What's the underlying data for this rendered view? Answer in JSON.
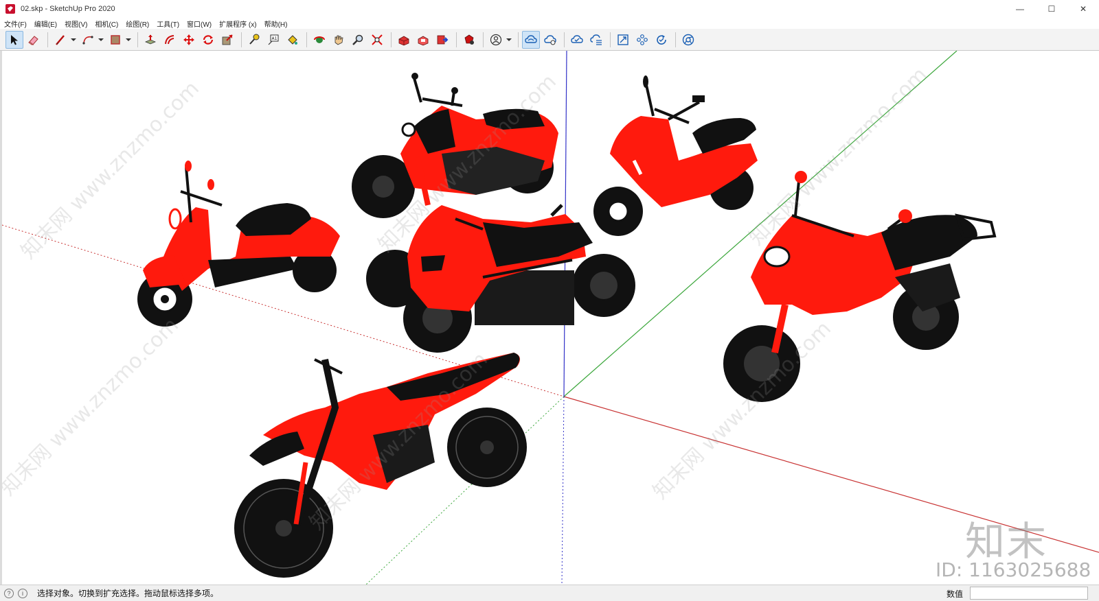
{
  "window": {
    "title": "02.skp - SketchUp Pro 2020",
    "controls": [
      "—",
      "☐",
      "✕"
    ]
  },
  "menu": [
    "文件(F)",
    "编辑(E)",
    "视图(V)",
    "相机(C)",
    "绘图(R)",
    "工具(T)",
    "窗口(W)",
    "扩展程序 (x)",
    "帮助(H)"
  ],
  "toolbar": {
    "tools": [
      "select-tool",
      "eraser-tool",
      "line-tool",
      "arc-tool",
      "shape-tool",
      "push-pull-tool",
      "offset-tool",
      "move-tool",
      "rotate-tool",
      "scale-tool",
      "tape-measure-tool",
      "text-tool",
      "paint-bucket-tool",
      "orbit-tool",
      "pan-tool",
      "zoom-tool",
      "zoom-extents-tool",
      "warehouse-tool",
      "extension-warehouse-tool",
      "send-to-layout-tool",
      "extension-manager-tool",
      "account-tool",
      "trimble-connect-tool",
      "cloud-add-tool",
      "cloud-sync-tool",
      "cloud-list-tool",
      "section-tool",
      "components-tool",
      "refresh-tool",
      "chrome-tool"
    ]
  },
  "status": {
    "message": "选择对象。切换到扩充选择。拖动鼠标选择多项。",
    "measure_label": "数值",
    "measure_value": ""
  },
  "watermark": {
    "logo": "知末",
    "id": "ID: 1163025688",
    "diagonal": "知末网 www.znzmo.com"
  },
  "colors": {
    "model_red": "#ff1a0d",
    "model_black": "#111111",
    "axis_red": "#c83232",
    "axis_green": "#3aa63a",
    "axis_blue": "#3232c8"
  }
}
